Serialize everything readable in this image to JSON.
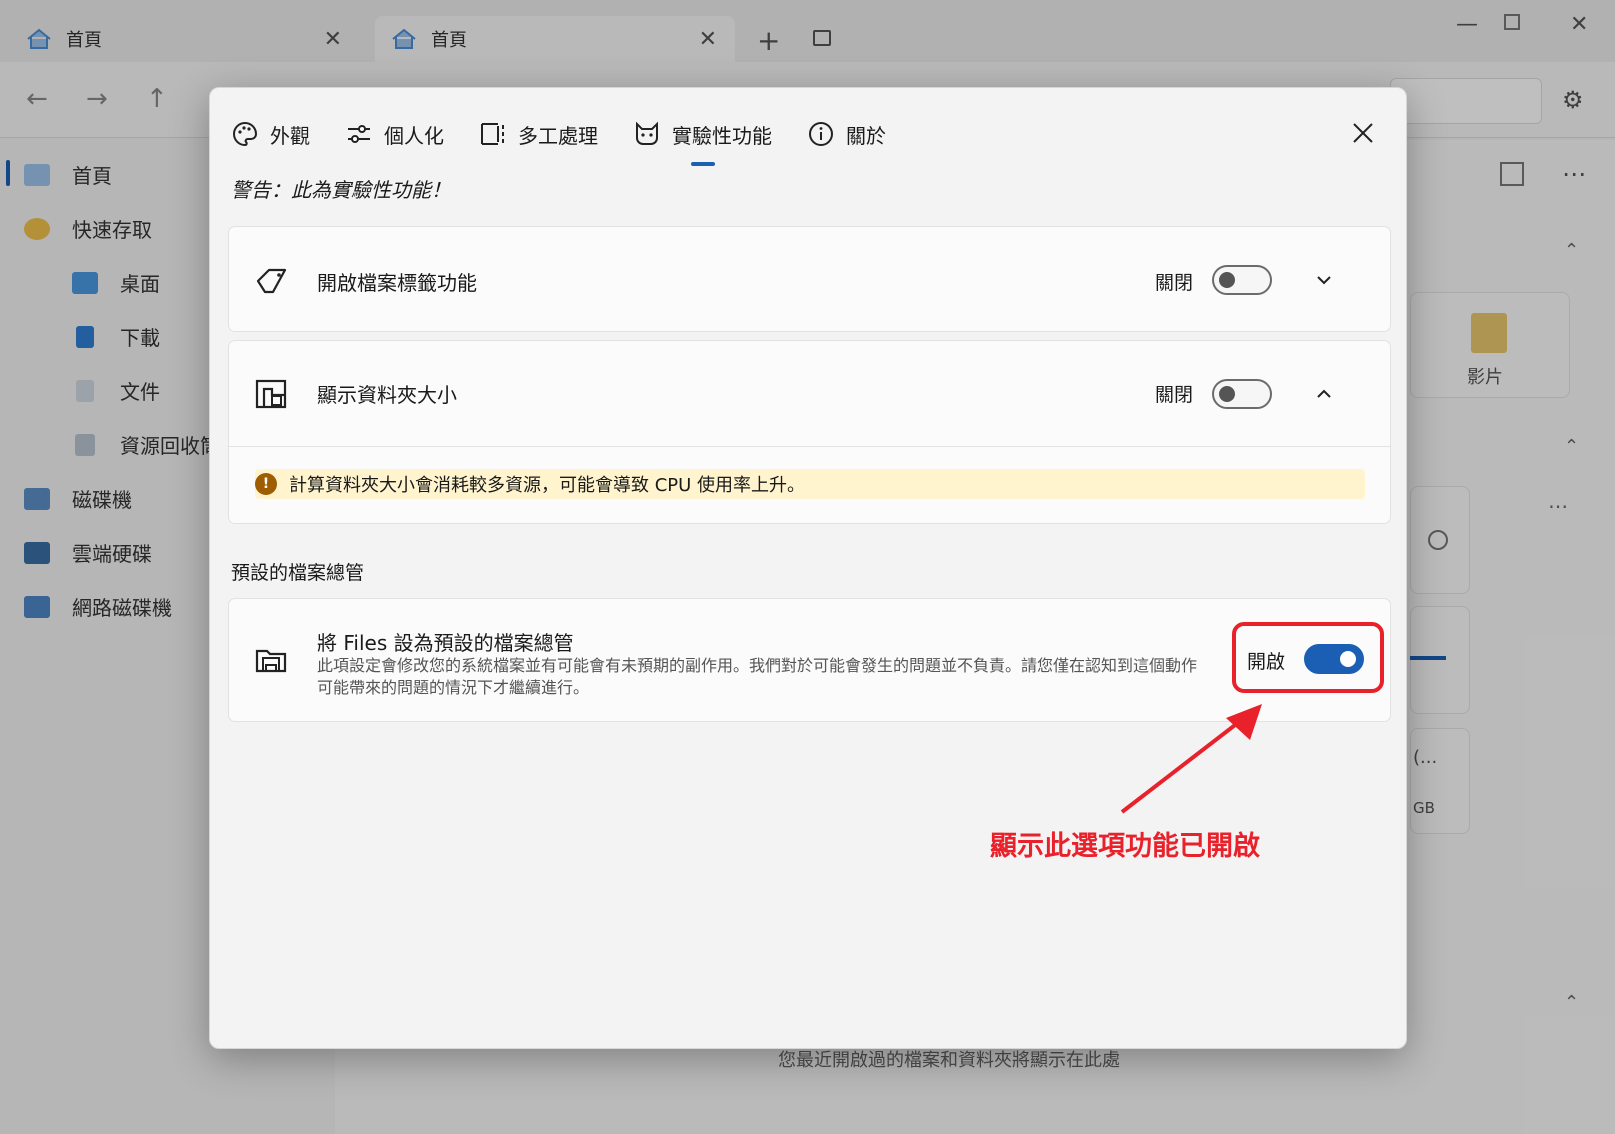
{
  "tabs": [
    {
      "label": "首頁"
    },
    {
      "label": "首頁"
    }
  ],
  "sidebar": {
    "items": [
      {
        "label": "首頁",
        "icon": "home-icon"
      },
      {
        "label": "快速存取",
        "icon": "star-icon"
      },
      {
        "label": "桌面",
        "icon": "desktop-icon"
      },
      {
        "label": "下載",
        "icon": "download-icon"
      },
      {
        "label": "文件",
        "icon": "document-icon"
      },
      {
        "label": "資源回收筒",
        "icon": "recycle-bin-icon"
      },
      {
        "label": "磁碟機",
        "icon": "drive-icon"
      },
      {
        "label": "雲端硬碟",
        "icon": "cloud-drive-icon"
      },
      {
        "label": "網路磁碟機",
        "icon": "network-drive-icon"
      }
    ]
  },
  "background": {
    "videos_label": "影片",
    "recent_placeholder": "您最近開啟過的檔案和資料夾將顯示在此處",
    "drive_partial_text": "(...",
    "drive_partial_unit": "GB"
  },
  "dialog": {
    "nav": [
      {
        "label": "外觀",
        "icon": "palette-icon"
      },
      {
        "label": "個人化",
        "icon": "sliders-icon"
      },
      {
        "label": "多工處理",
        "icon": "multitask-icon"
      },
      {
        "label": "實驗性功能",
        "icon": "flask-cat-icon",
        "active": true
      },
      {
        "label": "關於",
        "icon": "info-icon"
      }
    ],
    "warning": "警告：此為實驗性功能！",
    "settings": [
      {
        "label": "開啟檔案標籤功能",
        "state": "關閉",
        "enabled": false,
        "expanded": false,
        "icon": "tag-icon"
      },
      {
        "label": "顯示資料夾大小",
        "state": "關閉",
        "enabled": false,
        "expanded": true,
        "icon": "folder-size-icon",
        "info": "計算資料夾大小會消耗較多資源，可能會導致 CPU 使用率上升。"
      }
    ],
    "default_section": {
      "title": "預設的檔案總管",
      "setting_title": "將 Files 設為預設的檔案總管",
      "description": "此項設定會修改您的系統檔案並有可能會有未預期的副作用。我們對於可能會發生的問題並不負責。請您僅在認知到這個動作可能帶來的問題的情況下才繼續進行。",
      "state": "開啟",
      "enabled": true,
      "icon": "file-explorer-icon"
    }
  },
  "annotation": {
    "text": "顯示此選項功能已開啟",
    "color": "#e8212b"
  },
  "colors": {
    "accent": "#1a5fb4",
    "info_bg": "#fff4ce",
    "info_badge": "#9d5d00"
  }
}
